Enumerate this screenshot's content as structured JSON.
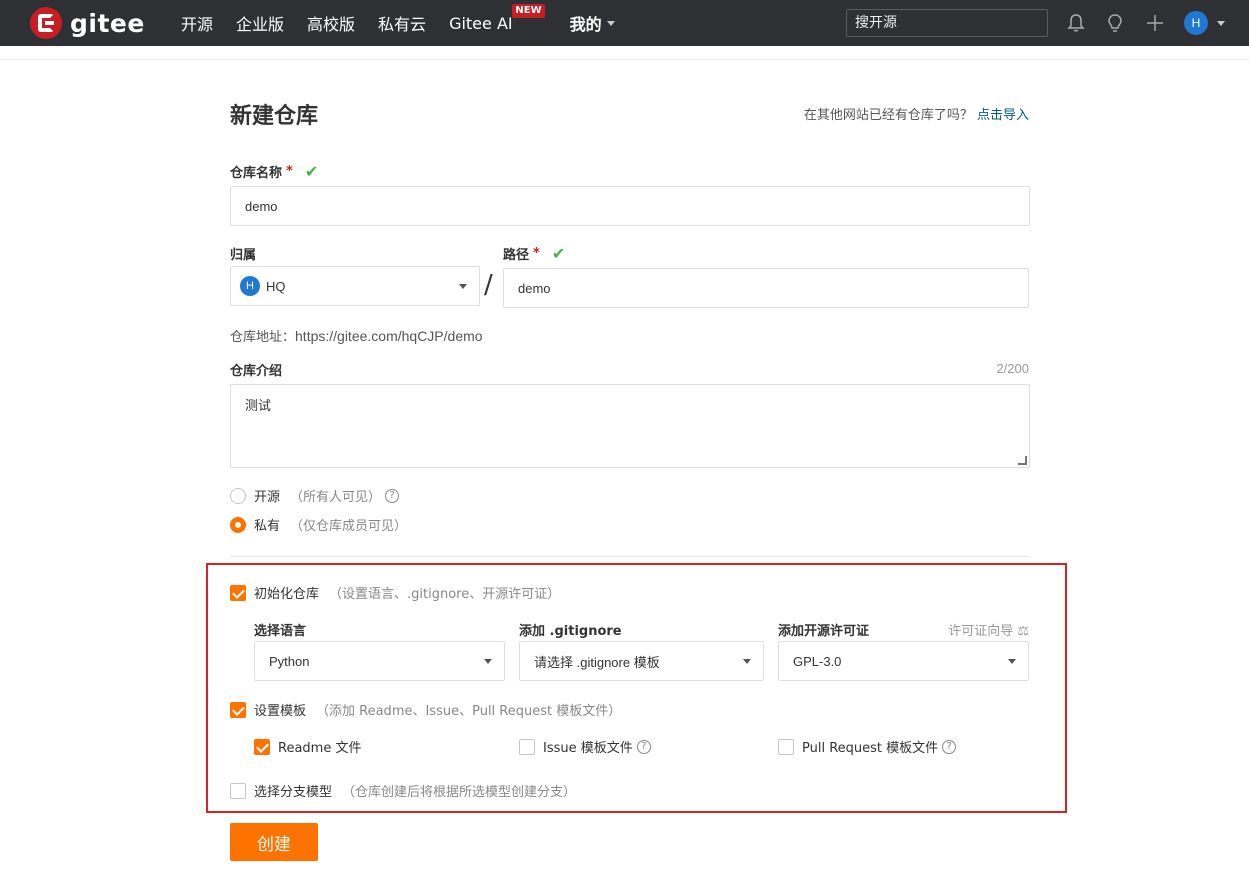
{
  "header": {
    "logo_text": "gitee",
    "nav": [
      "开源",
      "企业版",
      "高校版",
      "私有云",
      "Gitee AI"
    ],
    "nav_badge": "NEW",
    "mine": "我的",
    "search_placeholder": "搜开源",
    "avatar_letter": "H"
  },
  "page": {
    "title": "新建仓库",
    "import_prompt": "在其他网站已经有仓库了吗？",
    "import_link": "点击导入"
  },
  "form": {
    "name_label": "仓库名称",
    "name_value": "demo",
    "owner_label": "归属",
    "owner_avatar": "H",
    "owner_value": "HQ",
    "path_label": "路径",
    "path_value": "demo",
    "required_mark": "*",
    "slash": "/",
    "address_label": "仓库地址：",
    "address_value": "https://gitee.com/hqCJP/demo",
    "intro_label": "仓库介绍",
    "intro_counter": "2/200",
    "intro_value": "测试",
    "visibility": {
      "public_label": "开源",
      "public_hint": "（所有人可见）",
      "private_label": "私有",
      "private_hint": "（仅仓库成员可见）",
      "selected": "private"
    }
  },
  "init": {
    "init_label": "初始化仓库",
    "init_hint": "（设置语言、.gitignore、开源许可证）",
    "init_checked": true,
    "lang_label": "选择语言",
    "lang_value": "Python",
    "gitignore_label": "添加 .gitignore",
    "gitignore_value": "请选择 .gitignore 模板",
    "license_label": "添加开源许可证",
    "license_guide": "许可证向导",
    "license_value": "GPL-3.0",
    "template_label": "设置模板",
    "template_hint": "（添加 Readme、Issue、Pull Request 模板文件）",
    "template_checked": true,
    "readme_label": "Readme 文件",
    "issue_label": "Issue 模板文件",
    "pr_label": "Pull Request 模板文件",
    "branch_label": "选择分支模型",
    "branch_hint": "（仓库创建后将根据所选模型创建分支）"
  },
  "actions": {
    "create": "创建"
  },
  "colors": {
    "accent": "#fe7300",
    "header_bg": "#2e3033",
    "brand_red": "#c71d23",
    "highlight_border": "#d9221f"
  }
}
